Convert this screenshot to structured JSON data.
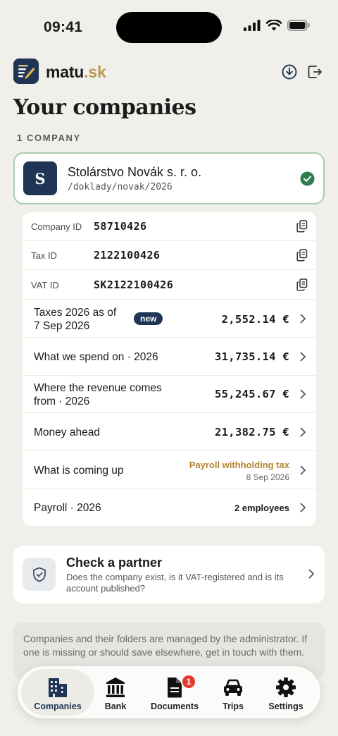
{
  "status_bar": {
    "time": "09:41"
  },
  "header": {
    "brand_name": "matu",
    "brand_tld": ".sk",
    "download_icon": "download-icon",
    "logout_icon": "logout-icon"
  },
  "page_title": "Your companies",
  "section_label": "1 COMPANY",
  "company": {
    "avatar_letter": "S",
    "name": "Stolárstvo Novák s. r. o.",
    "path": "/doklady/novak/2026",
    "selected": true
  },
  "identifiers": [
    {
      "label": "Company ID",
      "value": "58710426"
    },
    {
      "label": "Tax ID",
      "value": "2122100426"
    },
    {
      "label": "VAT ID",
      "value": "SK2122100426"
    }
  ],
  "summary": {
    "taxes": {
      "label_line1": "Taxes 2026 as of",
      "label_line2": "7 Sep 2026",
      "badge": "new",
      "amount": "2,552.14 €"
    },
    "spend": {
      "label": "What we spend on · 2026",
      "amount": "31,735.14 €"
    },
    "revenue": {
      "label_line1": "Where the revenue comes",
      "label_line2": "from · 2026",
      "amount": "55,245.67 €"
    },
    "money_ahead": {
      "label": "Money ahead",
      "amount": "21,382.75 €"
    },
    "upcoming": {
      "label": "What is coming up",
      "title": "Payroll withholding tax",
      "date": "8 Sep 2026"
    },
    "payroll": {
      "label": "Payroll · 2026",
      "value": "2 employees"
    }
  },
  "partner": {
    "title": "Check a partner",
    "description": "Does the company exist, is it VAT-registered and is its account published?"
  },
  "note": "Companies and their folders are managed by the administrator. If one is missing or should save elsewhere, get in touch with them.",
  "tabs": [
    {
      "label": "Companies",
      "icon": "buildings-icon",
      "active": true
    },
    {
      "label": "Bank",
      "icon": "bank-icon",
      "active": false
    },
    {
      "label": "Documents",
      "icon": "document-icon",
      "active": false,
      "badge": "1"
    },
    {
      "label": "Trips",
      "icon": "car-icon",
      "active": false
    },
    {
      "label": "Settings",
      "icon": "gear-icon",
      "active": false
    }
  ],
  "colors": {
    "background": "#f1efea",
    "brand_navy": "#1f3556",
    "brand_gold": "#b79a55",
    "success_green": "#2e7d4f",
    "upcoming_orange": "#b5822e",
    "badge_red": "#e23b30"
  }
}
